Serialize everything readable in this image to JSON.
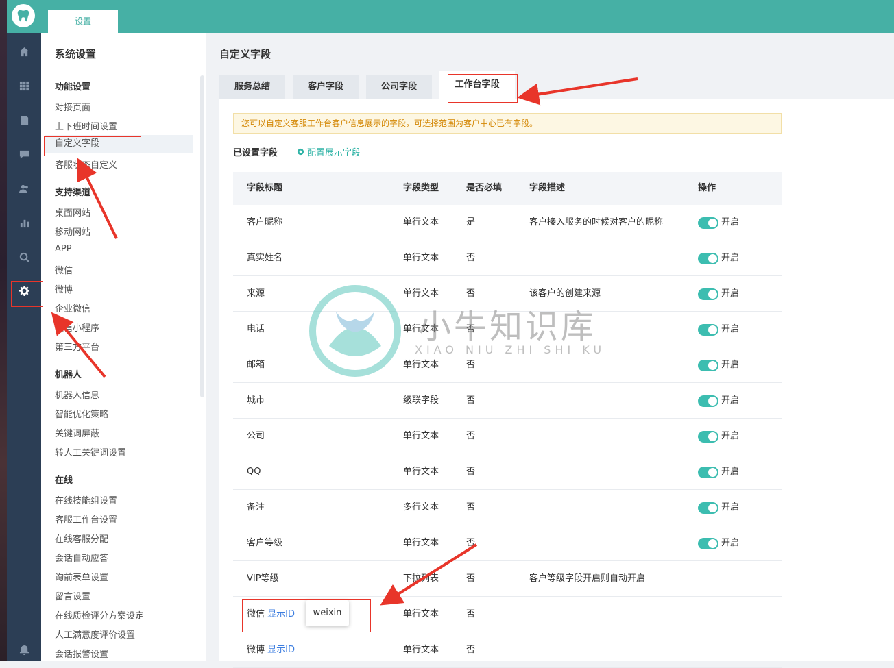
{
  "top": {
    "tab": "设置"
  },
  "sidebar": {
    "title": "系统设置",
    "groups": [
      {
        "label": "功能设置",
        "items": [
          "对接页面",
          "上下班时间设置",
          "自定义字段",
          "客服状态自定义"
        ]
      },
      {
        "label": "支持渠道",
        "items": [
          "桌面网站",
          "移动网站",
          "APP",
          "微信",
          "微博",
          "企业微信",
          "微信小程序",
          "第三方平台"
        ]
      },
      {
        "label": "机器人",
        "items": [
          "机器人信息",
          "智能优化策略",
          "关键词屏蔽",
          "转人工关键词设置"
        ]
      },
      {
        "label": "在线",
        "items": [
          "在线技能组设置",
          "客服工作台设置",
          "在线客服分配",
          "会话自动应答",
          "询前表单设置",
          "留言设置",
          "在线质检评分方案设定",
          "人工满意度评价设置",
          "会话报警设置"
        ]
      }
    ]
  },
  "main": {
    "title": "自定义字段",
    "tabs": [
      "服务总结",
      "客户字段",
      "公司字段",
      "工作台字段"
    ],
    "notice": "您可以自定义客服工作台客户信息展示的字段，可选择范围为客户中心已有字段。",
    "set_label": "已设置字段",
    "config_link": "配置展示字段",
    "columns": [
      "字段标题",
      "字段类型",
      "是否必填",
      "字段描述",
      "操作"
    ],
    "toggle_label": "开启",
    "show_id": "显示ID",
    "tooltip": "weixin",
    "rows": [
      {
        "title": "客户昵称",
        "type": "单行文本",
        "required": "是",
        "desc": "客户接入服务的时候对客户的昵称",
        "toggle": true
      },
      {
        "title": "真实姓名",
        "type": "单行文本",
        "required": "否",
        "desc": "",
        "toggle": true
      },
      {
        "title": "来源",
        "type": "单行文本",
        "required": "否",
        "desc": "该客户的创建来源",
        "toggle": true
      },
      {
        "title": "电话",
        "type": "单行文本",
        "required": "否",
        "desc": "",
        "toggle": true
      },
      {
        "title": "邮箱",
        "type": "单行文本",
        "required": "否",
        "desc": "",
        "toggle": true
      },
      {
        "title": "城市",
        "type": "级联字段",
        "required": "否",
        "desc": "",
        "toggle": true
      },
      {
        "title": "公司",
        "type": "单行文本",
        "required": "否",
        "desc": "",
        "toggle": true
      },
      {
        "title": "QQ",
        "type": "单行文本",
        "required": "否",
        "desc": "",
        "toggle": true
      },
      {
        "title": "备注",
        "type": "多行文本",
        "required": "否",
        "desc": "",
        "toggle": true
      },
      {
        "title": "客户等级",
        "type": "单行文本",
        "required": "否",
        "desc": "",
        "toggle": true
      },
      {
        "title": "VIP等级",
        "type": "下拉列表",
        "required": "否",
        "desc": "客户等级字段开启则自动开启",
        "toggle": false
      },
      {
        "title": "微信",
        "type": "单行文本",
        "required": "否",
        "desc": "",
        "toggle": false,
        "show_id": true
      },
      {
        "title": "微博",
        "type": "单行文本",
        "required": "否",
        "desc": "",
        "toggle": false,
        "show_id": true
      }
    ]
  },
  "watermark": {
    "title": "小牛知识库",
    "subtitle": "XIAO NIU ZHI SHI KU"
  },
  "colors": {
    "accent": "#46b0a5",
    "toggle": "#3cbdb0",
    "annotation": "#e8352a",
    "link": "#3d7ee0"
  }
}
